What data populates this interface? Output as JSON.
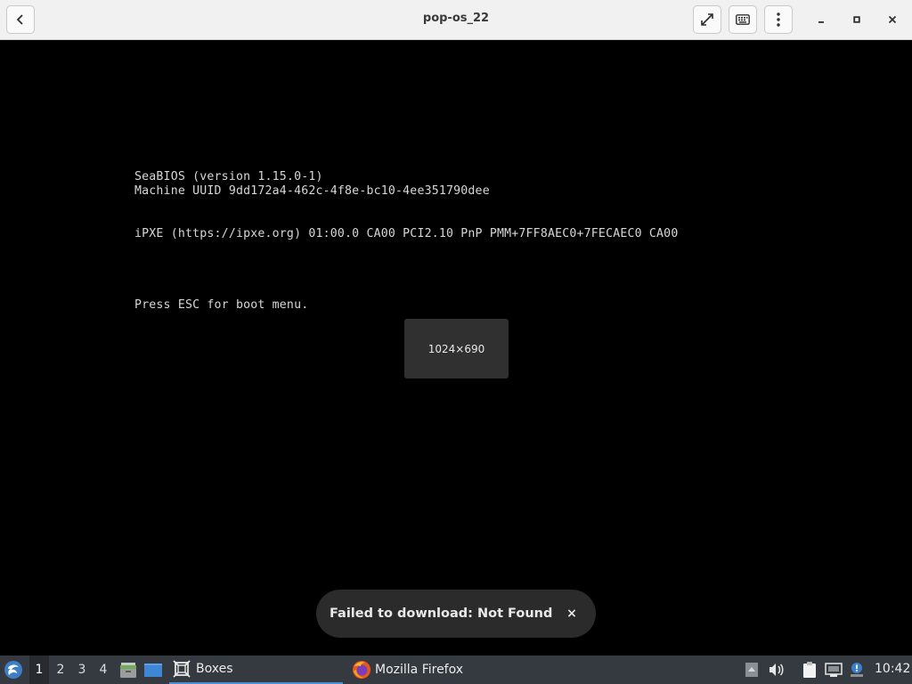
{
  "window": {
    "title": "pop-os_22",
    "back_icon": "chevron-left-icon",
    "fullscreen_icon": "fullscreen-icon",
    "keyboard_icon": "keyboard-icon",
    "menu_icon": "kebab-menu-icon",
    "minimize_icon": "minimize-icon",
    "maximize_icon": "maximize-icon",
    "close_icon": "close-icon"
  },
  "vm": {
    "bios_lines": [
      "SeaBIOS (version 1.15.0-1)",
      "Machine UUID 9dd172a4-462c-4f8e-bc10-4ee351790dee",
      "iPXE (https://ipxe.org) 01:00.0 CA00 PCI2.10 PnP PMM+7FF8AEC0+7FECAEC0 CA00",
      "Press ESC for boot menu."
    ],
    "resolution_overlay": "1024×690"
  },
  "toast": {
    "message": "Failed to download: Not Found",
    "close_label": "×"
  },
  "taskbar": {
    "workspaces": [
      "1",
      "2",
      "3",
      "4"
    ],
    "active_workspace": "1",
    "tasks": [
      {
        "label": "Boxes",
        "icon": "boxes-icon",
        "active": true
      },
      {
        "label": "Mozilla Firefox",
        "icon": "firefox-icon",
        "active": false
      }
    ],
    "clock": "10:42",
    "colors": {
      "bar": "#353a40",
      "accent": "#4a8fd1"
    }
  }
}
